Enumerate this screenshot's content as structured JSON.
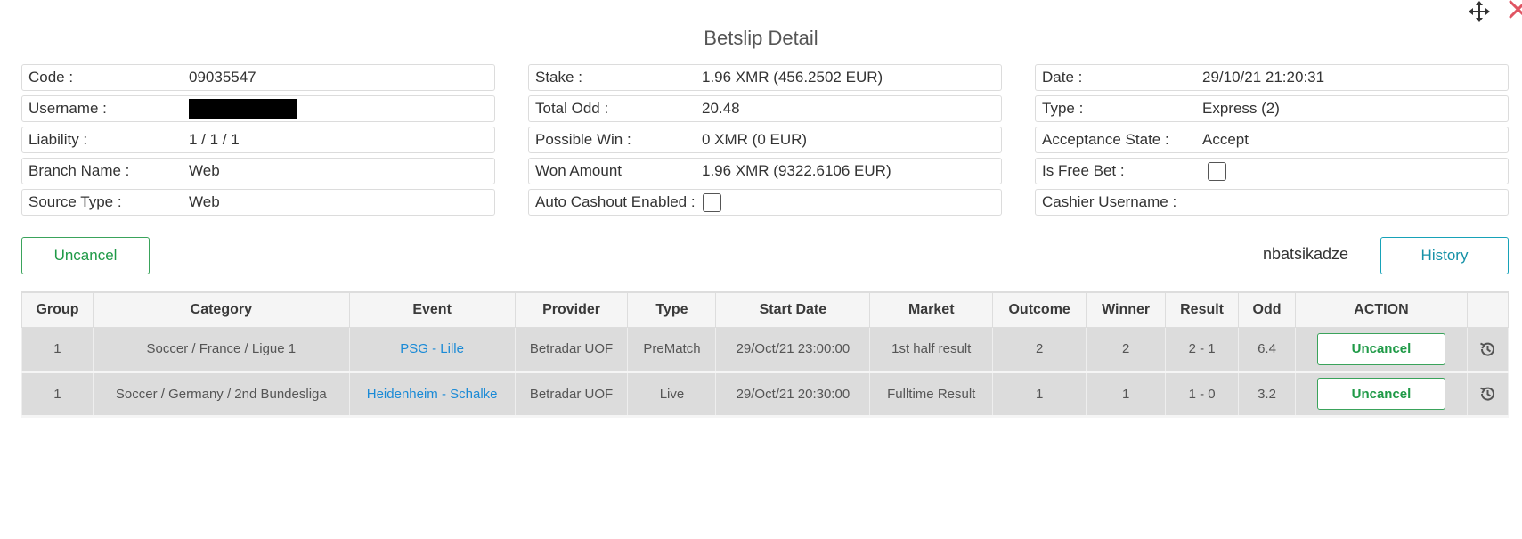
{
  "header": {
    "title": "Betslip Detail",
    "icons": {
      "move": "move-arrows-icon",
      "close": "close-icon"
    },
    "close_color": "#e05563"
  },
  "info": {
    "col1": [
      {
        "label": "Code :",
        "value": "09035547"
      },
      {
        "label": "Username :",
        "value": ""
      },
      {
        "label": "Liability :",
        "value": "1 / 1 / 1"
      },
      {
        "label": "Branch Name :",
        "value": "Web"
      },
      {
        "label": "Source Type :",
        "value": "Web"
      }
    ],
    "col2": [
      {
        "label": "Stake :",
        "value": "1.96 XMR (456.2502 EUR)"
      },
      {
        "label": "Total Odd :",
        "value": "20.48"
      },
      {
        "label": "Possible Win :",
        "value": "0 XMR (0 EUR)"
      },
      {
        "label": "Won Amount",
        "value": "1.96 XMR (9322.6106 EUR)"
      },
      {
        "label": "Auto Cashout Enabled :",
        "value": ""
      }
    ],
    "col3": [
      {
        "label": "Date :",
        "value": "29/10/21 21:20:31"
      },
      {
        "label": "Type :",
        "value": "Express (2)"
      },
      {
        "label": "Acceptance State :",
        "value": "Accept"
      },
      {
        "label": "Is Free Bet :",
        "value": ""
      },
      {
        "label": "Cashier Username :",
        "value": ""
      }
    ],
    "auto_cashout_checked": false,
    "is_free_bet_checked": false
  },
  "actions": {
    "uncancel_label": "Uncancel",
    "username": "nbatsikadze",
    "history_label": "History"
  },
  "table": {
    "columns": [
      "Group",
      "Category",
      "Event",
      "Provider",
      "Type",
      "Start Date",
      "Market",
      "Outcome",
      "Winner",
      "Result",
      "Odd",
      "ACTION",
      ""
    ],
    "rows": [
      {
        "group": "1",
        "category": "Soccer / France / Ligue 1",
        "event": "PSG - Lille",
        "provider": "Betradar UOF",
        "type": "PreMatch",
        "start_date": "29/Oct/21 23:00:00",
        "market": "1st half result",
        "outcome": "2",
        "winner": "2",
        "result": "2 - 1",
        "odd": "6.4",
        "action": "Uncancel"
      },
      {
        "group": "1",
        "category": "Soccer / Germany / 2nd Bundesliga",
        "event": "Heidenheim - Schalke",
        "provider": "Betradar UOF",
        "type": "Live",
        "start_date": "29/Oct/21 20:30:00",
        "market": "Fulltime Result",
        "outcome": "1",
        "winner": "1",
        "result": "1 - 0",
        "odd": "3.2",
        "action": "Uncancel"
      }
    ],
    "row_icon": "history-icon"
  },
  "colors": {
    "green_accent": "#1f9a47",
    "teal_accent": "#1591a7",
    "link_blue": "#1a8ad6"
  }
}
